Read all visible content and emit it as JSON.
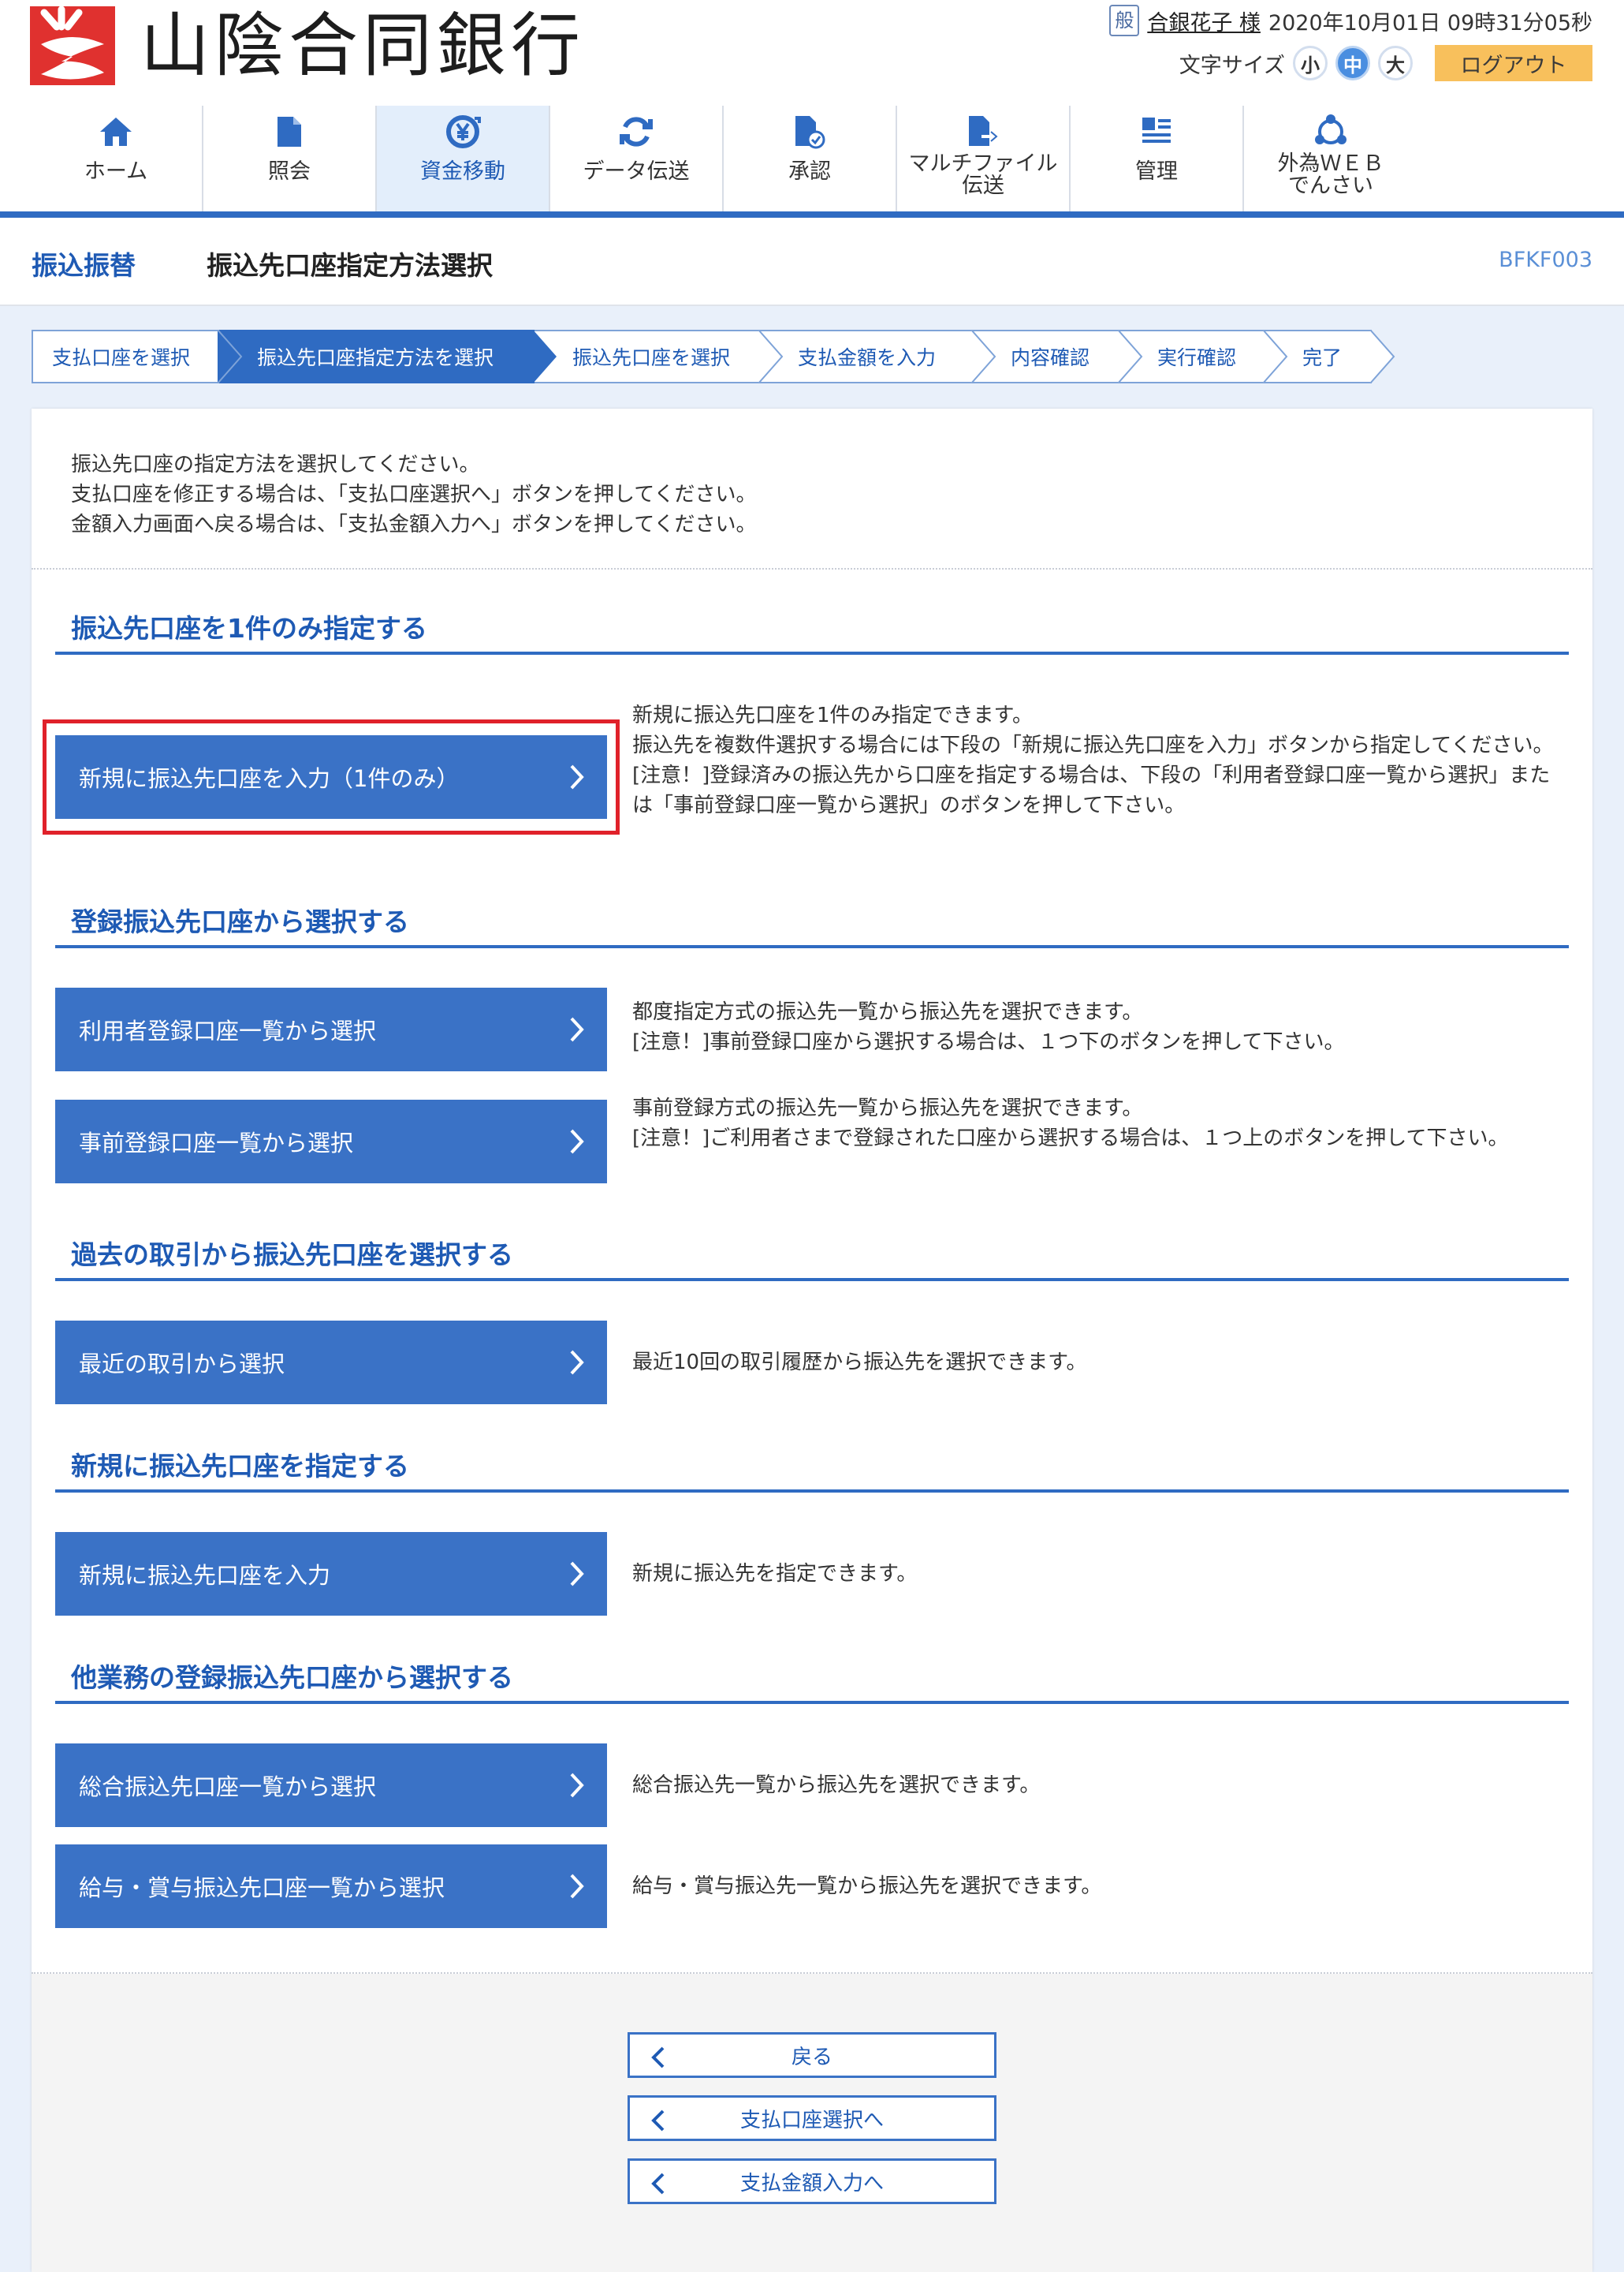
{
  "header": {
    "bank_name": "山陰合同銀行",
    "user_badge": "般",
    "user_name": "合銀花子 様",
    "datetime": "2020年10月01日 09時31分05秒",
    "font_size_label": "文字サイズ",
    "font_sizes": [
      "小",
      "中",
      "大"
    ],
    "logout_label": "ログアウト"
  },
  "nav": {
    "items": [
      {
        "label": "ホーム"
      },
      {
        "label": "照会"
      },
      {
        "label": "資金移動"
      },
      {
        "label": "データ伝送"
      },
      {
        "label": "承認"
      },
      {
        "label": "マルチファイル\n伝送"
      },
      {
        "label": "管理"
      },
      {
        "label": "外為ＷＥＢ\nでんさい"
      }
    ]
  },
  "title": {
    "category": "振込振替",
    "main": "振込先口座指定方法選択",
    "code": "BFKF003"
  },
  "steps": [
    "支払口座を選択",
    "振込先口座指定方法を選択",
    "振込先口座を選択",
    "支払金額を入力",
    "内容確認",
    "実行確認",
    "完了"
  ],
  "intro": [
    "振込先口座の指定方法を選択してください。",
    "支払口座を修正する場合は、「支払口座選択へ」ボタンを押してください。",
    "金額入力画面へ戻る場合は、「支払金額入力へ」ボタンを押してください。"
  ],
  "sections": [
    {
      "title": "振込先口座を1件のみ指定する",
      "options": [
        {
          "label": "新規に振込先口座を入力（1件のみ）",
          "desc": "新規に振込先口座を1件のみ指定できます。\n振込先を複数件選択する場合には下段の「新規に振込先口座を入力」ボタンから指定してください。\n[注意！]登録済みの振込先から口座を指定する場合は、下段の「利用者登録口座一覧から選択」または「事前登録口座一覧から選択」のボタンを押して下さい。"
        }
      ]
    },
    {
      "title": "登録振込先口座から選択する",
      "options": [
        {
          "label": "利用者登録口座一覧から選択",
          "desc": "都度指定方式の振込先一覧から振込先を選択できます。\n[注意！]事前登録口座から選択する場合は、１つ下のボタンを押して下さい。"
        },
        {
          "label": "事前登録口座一覧から選択",
          "desc": "事前登録方式の振込先一覧から振込先を選択できます。\n[注意！]ご利用者さまで登録された口座から選択する場合は、１つ上のボタンを押して下さい。"
        }
      ]
    },
    {
      "title": "過去の取引から振込先口座を選択する",
      "options": [
        {
          "label": "最近の取引から選択",
          "desc": "最近10回の取引履歴から振込先を選択できます。"
        }
      ]
    },
    {
      "title": "新規に振込先口座を指定する",
      "options": [
        {
          "label": "新規に振込先口座を入力",
          "desc": "新規に振込先を指定できます。"
        }
      ]
    },
    {
      "title": "他業務の登録振込先口座から選択する",
      "options": [
        {
          "label": "総合振込先口座一覧から選択",
          "desc": "総合振込先一覧から振込先を選択できます。"
        },
        {
          "label": "給与・賞与振込先口座一覧から選択",
          "desc": "給与・賞与振込先一覧から振込先を選択できます。"
        }
      ]
    }
  ],
  "footer": {
    "back_label": "戻る",
    "to_payment_account_label": "支払口座選択へ",
    "to_payment_amount_label": "支払金額入力へ"
  },
  "colors": {
    "brand_blue": "#2f6bc2",
    "button_blue": "#3a72c6",
    "logout_orange": "#f8c05c",
    "highlight_red": "#e0212a",
    "logo_red": "#e0312f"
  },
  "icons": [
    "home-icon",
    "document-icon",
    "yen-transfer-icon",
    "sync-icon",
    "approval-icon",
    "file-transfer-icon",
    "management-icon",
    "foreign-exchange-icon",
    "chevron-right-icon",
    "chevron-left-icon"
  ]
}
